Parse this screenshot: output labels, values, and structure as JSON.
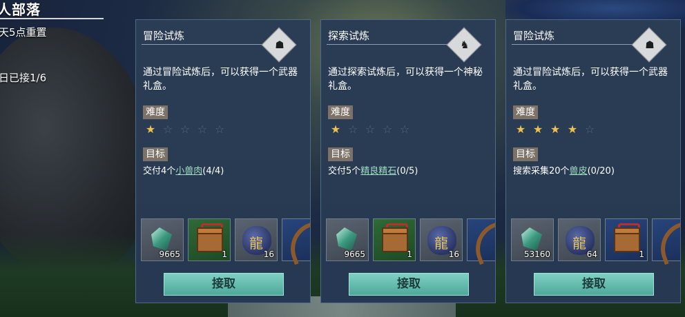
{
  "hud": {
    "title": "人部落",
    "reset_text": "天5点重置",
    "daily_count": "日已接1/6"
  },
  "cards": [
    {
      "title": "冒险试炼",
      "emblem_icon": "mask-icon",
      "description": "通过冒险试炼后，可以获得一个武器礼盒。",
      "difficulty_label": "难度",
      "difficulty": 1,
      "difficulty_max": 5,
      "goal_label": "目标",
      "goal_prefix": "交付4个",
      "goal_item": "小兽肉",
      "goal_progress": "(4/4)",
      "rewards": [
        {
          "icon": "jade-crystal-icon",
          "qty": "9665"
        },
        {
          "icon": "treasure-chest-icon",
          "qty": "1"
        },
        {
          "icon": "dragon-stone-icon",
          "qty": "16"
        },
        {
          "icon": "horn-icon",
          "qty": ""
        }
      ],
      "accept_label": "接取"
    },
    {
      "title": "探索试炼",
      "emblem_icon": "dragon-emblem-icon",
      "description": "通过探索试炼后，可以获得一个神秘礼盒。",
      "difficulty_label": "难度",
      "difficulty": 1,
      "difficulty_max": 5,
      "goal_label": "目标",
      "goal_prefix": "交付5个",
      "goal_item": "精良精石",
      "goal_progress": "(0/5)",
      "rewards": [
        {
          "icon": "jade-crystal-icon",
          "qty": "9665"
        },
        {
          "icon": "treasure-chest-icon",
          "qty": "1"
        },
        {
          "icon": "dragon-stone-icon",
          "qty": "16"
        },
        {
          "icon": "horn-icon",
          "qty": ""
        }
      ],
      "accept_label": "接取"
    },
    {
      "title": "冒险试炼",
      "emblem_icon": "mask-icon",
      "description": "通过冒险试炼后，可以获得一个武器礼盒。",
      "difficulty_label": "难度",
      "difficulty": 4,
      "difficulty_max": 5,
      "goal_label": "目标",
      "goal_prefix": "搜索采集20个",
      "goal_item": "兽皮",
      "goal_progress": "(0/20)",
      "rewards": [
        {
          "icon": "jade-crystal-icon",
          "qty": "53160"
        },
        {
          "icon": "dragon-stone-icon",
          "qty": "64"
        },
        {
          "icon": "treasure-chest-icon",
          "qty": "1"
        },
        {
          "icon": "horn-icon",
          "qty": ""
        }
      ],
      "accept_label": "接取"
    }
  ]
}
